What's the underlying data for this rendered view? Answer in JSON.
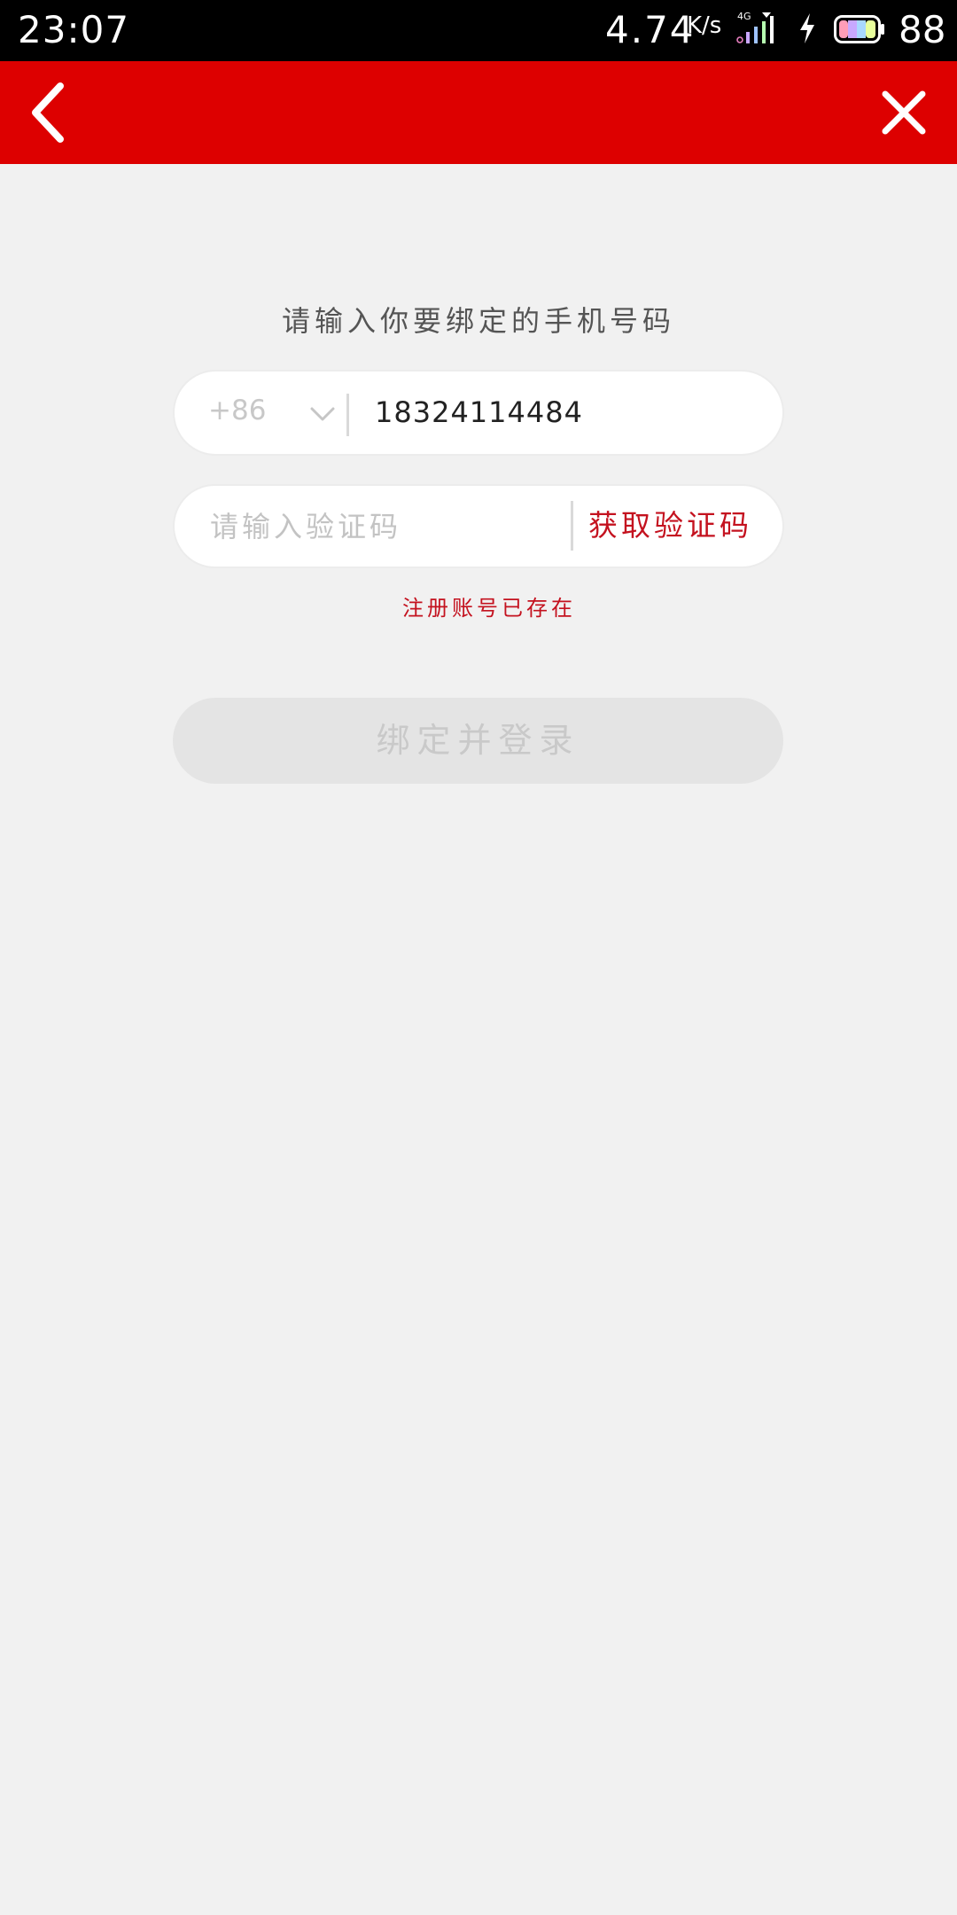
{
  "status_bar": {
    "time": "23:07",
    "net_speed": "4.74",
    "net_speed_unit": "K/s",
    "network_type": "4G",
    "battery_level": "88",
    "icons": [
      "signal-icon",
      "charging-bolt-icon",
      "battery-icon"
    ]
  },
  "app_bar": {
    "background": "#dd0000",
    "icons": {
      "back": "chevron-left-icon",
      "close": "close-icon"
    }
  },
  "form": {
    "prompt": "请输入你要绑定的手机号码",
    "country_code": "+86",
    "phone_value": "18324114484",
    "code_placeholder": "请输入验证码",
    "get_code_label": "获取验证码",
    "error_message": "注册账号已存在",
    "submit_label": "绑定并登录",
    "submit_enabled": false
  },
  "colors": {
    "accent": "#c4121f",
    "header": "#dd0000",
    "page_background": "#f1f1f1"
  }
}
